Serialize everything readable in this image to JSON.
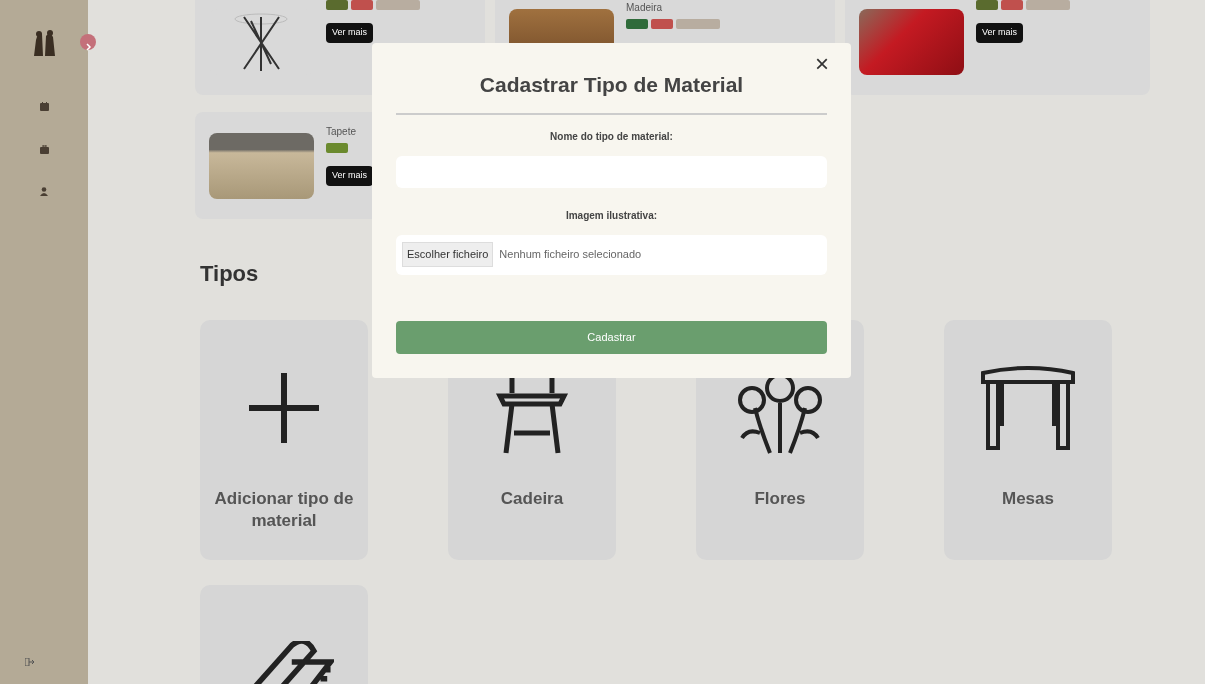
{
  "products": [
    {
      "kind": "line-art",
      "badges": [
        {
          "color": "#5a6b2e"
        },
        {
          "color": "#c0504d"
        },
        {
          "color": "#b8ada0"
        }
      ],
      "button": "Ver mais"
    },
    {
      "kind": "photo",
      "title": "Madeira",
      "badges": [
        {
          "color": "#2f6b3a"
        },
        {
          "color": "#c0504d"
        },
        {
          "color": "#b8ada0"
        }
      ]
    },
    {
      "kind": "photo",
      "badges": [
        {
          "color": "#5a6b2e"
        },
        {
          "color": "#c0504d"
        },
        {
          "color": "#b8ada0"
        }
      ],
      "button": "Ver mais"
    },
    {
      "kind": "photo",
      "title": "Tapete",
      "badges": [
        {
          "color": "#6b8a2e"
        }
      ],
      "button": "Ver mais"
    }
  ],
  "types_heading": "Tipos",
  "types": [
    {
      "kind": "add",
      "label": "Adicionar tipo de material"
    },
    {
      "kind": "chair",
      "label": "Cadeira"
    },
    {
      "kind": "flowers",
      "label": "Flores"
    },
    {
      "kind": "table",
      "label": "Mesas"
    },
    {
      "kind": "rug"
    }
  ],
  "modal": {
    "title": "Cadastrar Tipo de Material",
    "close": "×",
    "fields": [
      {
        "kind": "text",
        "label": "Nome do tipo de material:"
      },
      {
        "kind": "file",
        "label": "Imagem ilustrativa:",
        "button": "Escolher ficheiro",
        "status": "Nenhum ficheiro selecionado"
      }
    ],
    "submit": "Cadastrar"
  }
}
